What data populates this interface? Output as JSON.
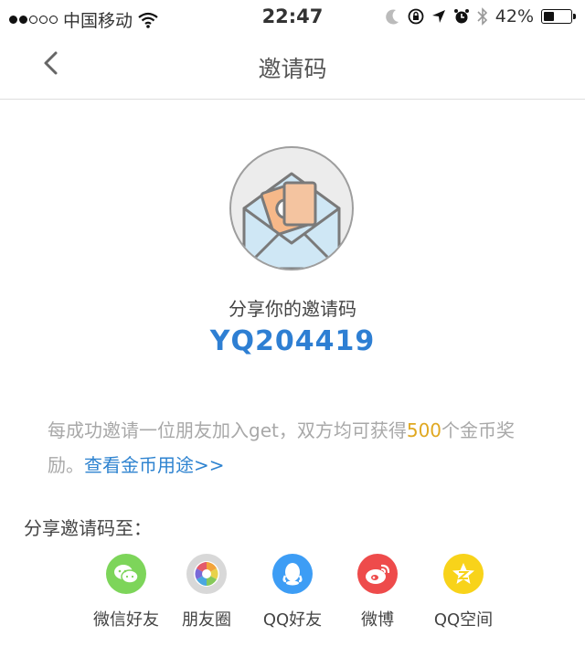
{
  "status_bar": {
    "carrier": "中国移动",
    "time": "22:47",
    "battery": "42%",
    "battery_level": 0.42
  },
  "nav": {
    "title": "邀请码",
    "back_icon": "chevron-left-icon"
  },
  "invite": {
    "label": "分享你的邀请码",
    "code": "YQ204419"
  },
  "description": {
    "text_before": "每成功邀请一位朋友加入get，双方均可获得",
    "highlight": "500",
    "text_after": "个金币奖励。",
    "link": "查看金币用途>>"
  },
  "share": {
    "title": "分享邀请码至：",
    "items": [
      {
        "label": "微信好友",
        "icon": "wechat-icon",
        "color": "#7dd55a"
      },
      {
        "label": "朋友圈",
        "icon": "moments-icon",
        "color": "#d8d8d8"
      },
      {
        "label": "QQ好友",
        "icon": "qq-icon",
        "color": "#3d9df5"
      },
      {
        "label": "微博",
        "icon": "weibo-icon",
        "color": "#ee4b4b"
      },
      {
        "label": "QQ空间",
        "icon": "qzone-icon",
        "color": "#f8d31a"
      }
    ]
  },
  "colors": {
    "accent": "#2e7fd3",
    "highlight": "#e0a821",
    "link": "#2e83d0"
  }
}
